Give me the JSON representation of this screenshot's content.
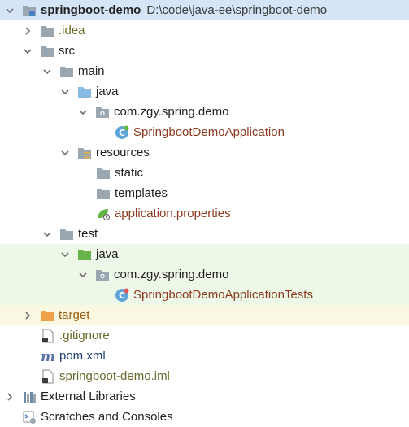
{
  "tree": {
    "root": {
      "name": "springboot-demo",
      "path": "D:\\code\\java-ee\\springboot-demo"
    },
    "items": [
      {
        "label": ".idea"
      },
      {
        "label": "src"
      },
      {
        "label": "main"
      },
      {
        "label": "java"
      },
      {
        "label": "com.zgy.spring.demo"
      },
      {
        "label": "SpringbootDemoApplication"
      },
      {
        "label": "resources"
      },
      {
        "label": "static"
      },
      {
        "label": "templates"
      },
      {
        "label": "application.properties"
      },
      {
        "label": "test"
      },
      {
        "label": "java"
      },
      {
        "label": "com.zgy.spring.demo"
      },
      {
        "label": "SpringbootDemoApplicationTests"
      },
      {
        "label": "target"
      },
      {
        "label": ".gitignore"
      },
      {
        "label": "pom.xml"
      },
      {
        "label": "springboot-demo.iml"
      }
    ],
    "external_libraries": "External Libraries",
    "scratches": "Scratches and Consoles"
  },
  "colors": {
    "selection": "#d5e4f7",
    "test_highlight": "#eef8e8",
    "excluded_highlight": "#fbf8e1",
    "folder_grey": "#9aa7b0",
    "folder_blue": "#87bbe2",
    "folder_green": "#68b34a",
    "folder_orange": "#f0a24a"
  }
}
